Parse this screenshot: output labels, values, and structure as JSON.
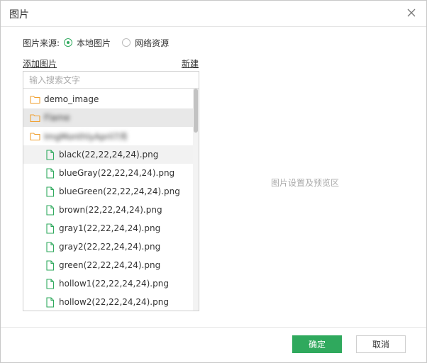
{
  "dialog": {
    "title": "图片",
    "close_icon": "close-icon"
  },
  "source": {
    "label": "图片来源:",
    "options": [
      {
        "label": "本地图片",
        "selected": true
      },
      {
        "label": "网络资源",
        "selected": false
      }
    ]
  },
  "actions": {
    "add_image": "添加图片",
    "new": "新建"
  },
  "search": {
    "placeholder": "输入搜索文字",
    "value": ""
  },
  "tree": {
    "folders": [
      {
        "label": "demo_image",
        "icon": "folder-icon"
      },
      {
        "label": "Flame",
        "icon": "folder-icon",
        "blurred": true
      },
      {
        "label": "ImgMonthlyApril7月",
        "icon": "folder-icon",
        "blurred": true
      }
    ],
    "files": [
      {
        "label": "black(22,22,24,24).png",
        "icon": "file-icon"
      },
      {
        "label": "blueGray(22,22,24,24).png",
        "icon": "file-icon"
      },
      {
        "label": "blueGreen(22,22,24,24).png",
        "icon": "file-icon"
      },
      {
        "label": "brown(22,22,24,24).png",
        "icon": "file-icon"
      },
      {
        "label": "gray1(22,22,24,24).png",
        "icon": "file-icon"
      },
      {
        "label": "gray2(22,22,24,24).png",
        "icon": "file-icon"
      },
      {
        "label": "green(22,22,24,24).png",
        "icon": "file-icon"
      },
      {
        "label": "hollow1(22,22,24,24).png",
        "icon": "file-icon"
      },
      {
        "label": "hollow2(22,22,24,24).png",
        "icon": "file-icon"
      }
    ]
  },
  "preview": {
    "hint": "图片设置及预览区"
  },
  "footer": {
    "ok": "确定",
    "cancel": "取消"
  },
  "colors": {
    "accent": "#2fa95d",
    "folder": "#f0a030",
    "file": "#2fa95d"
  }
}
